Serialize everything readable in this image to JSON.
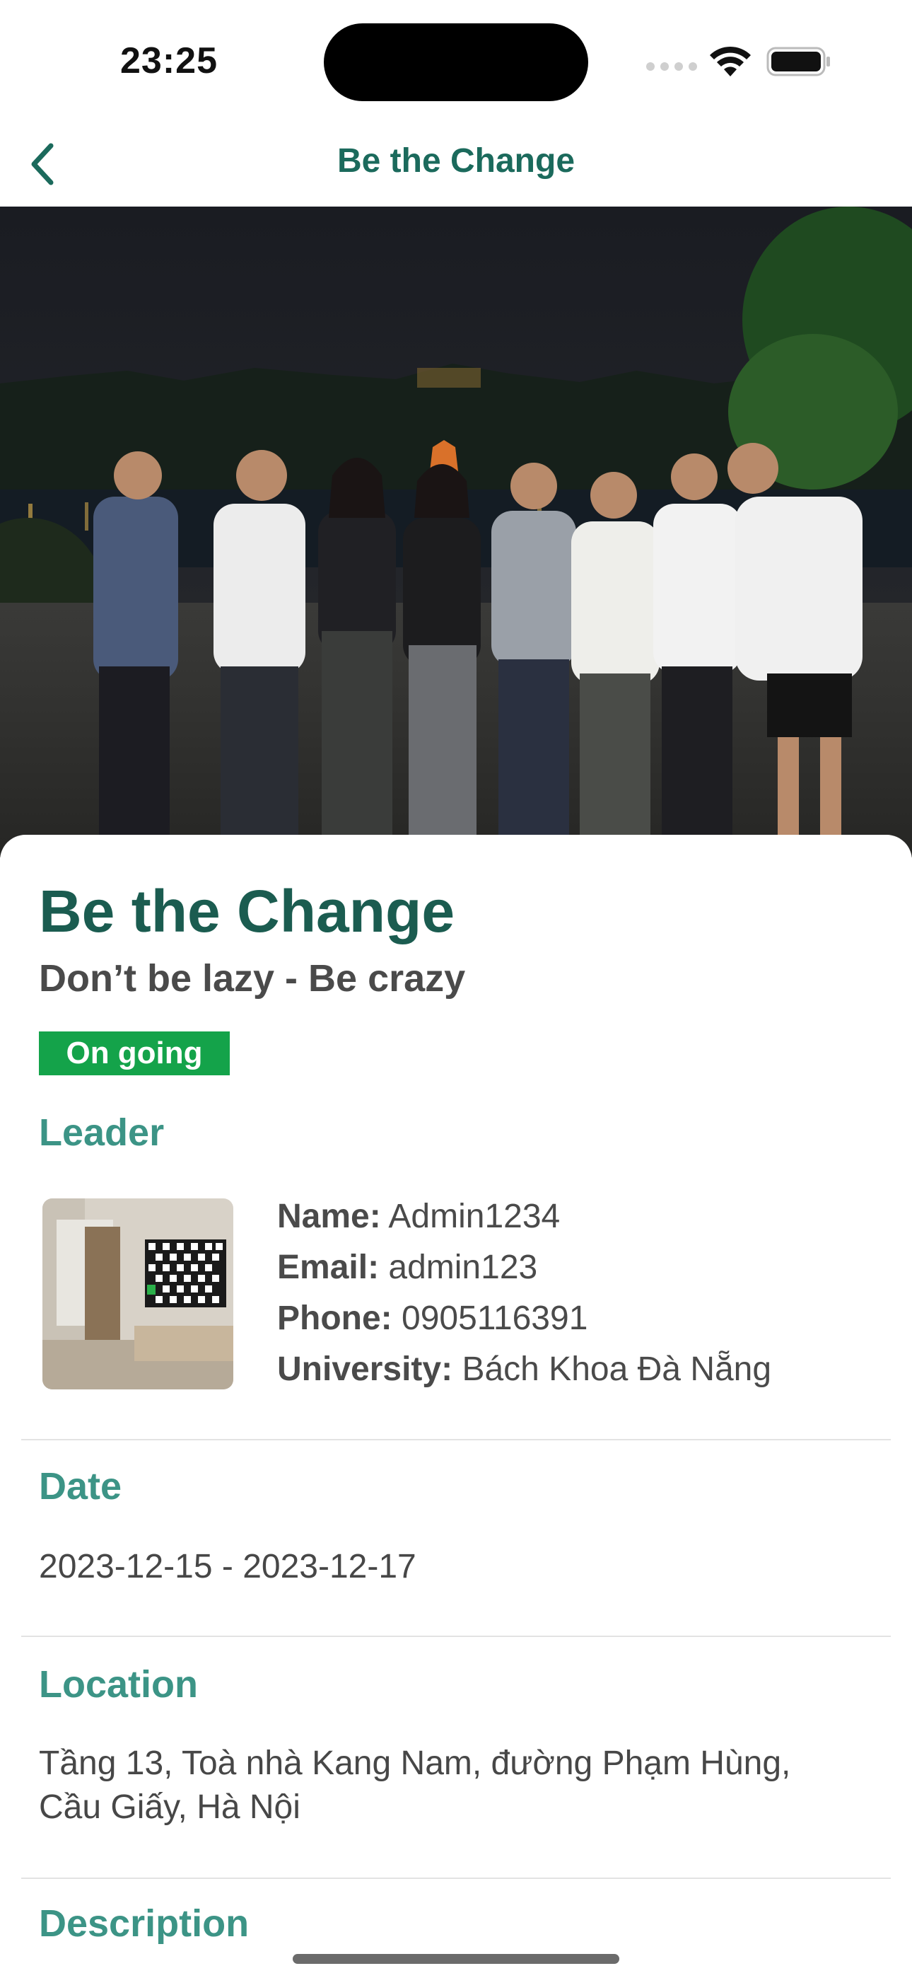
{
  "status_bar": {
    "time": "23:25"
  },
  "nav": {
    "title": "Be the Change"
  },
  "project": {
    "title": "Be the Change",
    "slogan": "Don’t be lazy - Be crazy",
    "status": "On going"
  },
  "leader": {
    "heading": "Leader",
    "name_label": "Name:",
    "name": "Admin1234",
    "email_label": "Email:",
    "email": "admin123",
    "phone_label": "Phone:",
    "phone": "0905116391",
    "university_label": "University:",
    "university": "Bách Khoa Đà Nẵng"
  },
  "date": {
    "heading": "Date",
    "value": "2023-12-15 - 2023-12-17"
  },
  "location": {
    "heading": "Location",
    "line1": "Tầng 13, Toà nhà Kang Nam, đường Phạm Hùng,",
    "line2": "Cầu Giấy, Hà Nội"
  },
  "description": {
    "heading": "Description"
  },
  "colors": {
    "primary": "#1b6a5c",
    "heading": "#3c9486",
    "badge": "#14a34a"
  }
}
